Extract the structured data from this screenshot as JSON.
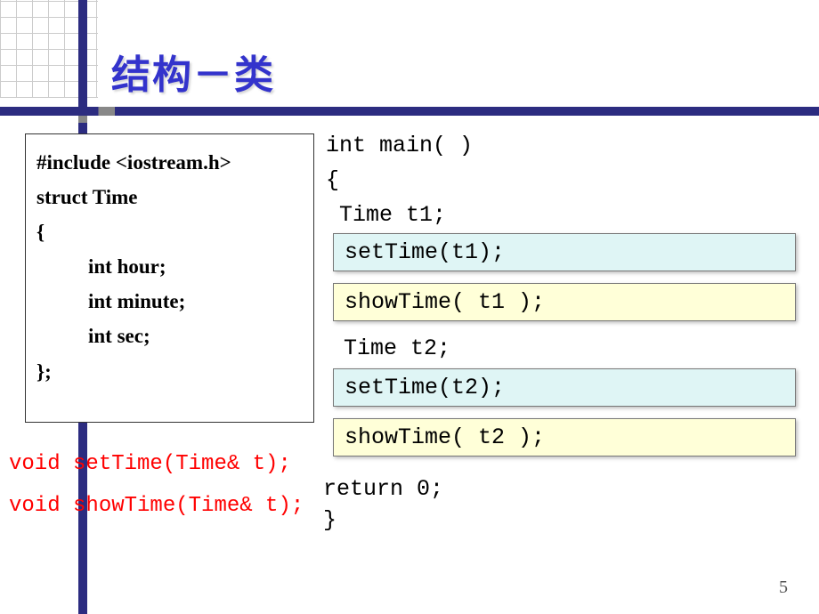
{
  "title": "结构－类",
  "struct_code": {
    "line1": "#include <iostream.h>",
    "line2": "struct Time",
    "line3": "{",
    "line4": "int hour;",
    "line5": "int minute;",
    "line6": "int sec;",
    "line7": "};"
  },
  "func_declarations": {
    "setTime": "void setTime(Time& t);",
    "showTime": "void showTime(Time& t);"
  },
  "main_code": {
    "line1": "int main( )",
    "line2": "{",
    "line3": " Time t1;",
    "call_setTime_t1": "setTime(t1);",
    "call_showTime_t1": "showTime( t1 );",
    "line_t2": "Time t2;",
    "call_setTime_t2": "setTime(t2);",
    "call_showTime_t2": "showTime( t2 );",
    "return": "return 0;",
    "close": "}"
  },
  "page_number": "5"
}
